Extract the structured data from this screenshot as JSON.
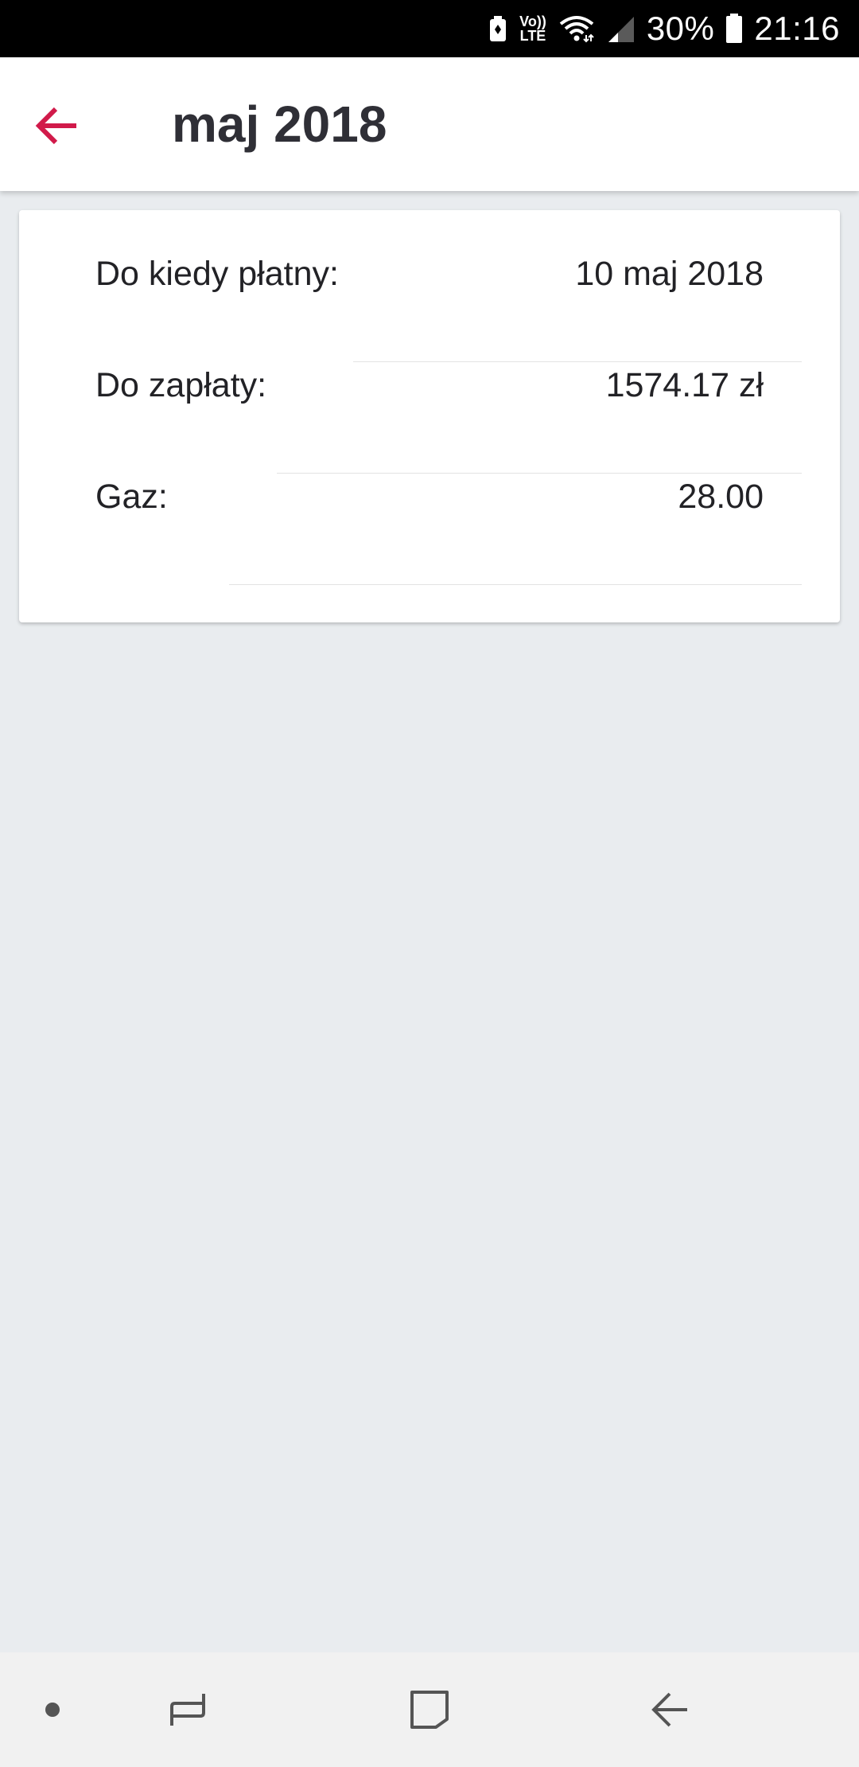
{
  "status_bar": {
    "volte_top": "Vo))",
    "volte_bottom": "LTE",
    "battery_percent": "30%",
    "time": "21:16",
    "icons": [
      "battery-saver-icon",
      "volte-icon",
      "wifi-icon",
      "signal-icon",
      "battery-icon"
    ]
  },
  "app_bar": {
    "title": "maj 2018",
    "back_icon": "arrow-left-icon",
    "accent_color": "#d11a4a"
  },
  "details": {
    "rows": [
      {
        "label": "Do kiedy płatny:",
        "value": "10 maj 2018"
      },
      {
        "label": "Do zapłaty:",
        "value": "1574.17 zł"
      },
      {
        "label": "Gaz:",
        "value": "28.00"
      }
    ]
  },
  "nav_bar": {
    "icons": [
      "dot-icon",
      "recent-apps-icon",
      "home-icon",
      "back-icon"
    ]
  },
  "colors": {
    "background": "#e9ecef",
    "card": "#ffffff",
    "text": "#222226",
    "status_bar": "#000000"
  }
}
